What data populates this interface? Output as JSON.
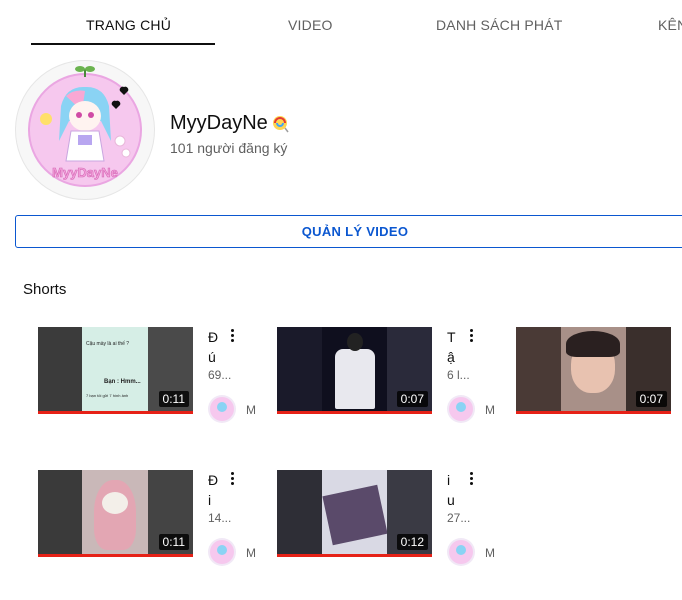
{
  "tabs": [
    {
      "label": "TRANG CHỦ",
      "active": true
    },
    {
      "label": "VIDEO",
      "active": false
    },
    {
      "label": "DANH SÁCH PHÁT",
      "active": false
    },
    {
      "label": "KÊN",
      "active": false
    }
  ],
  "channel": {
    "name": "MyyDayNe",
    "name_icon": "lollipop-icon",
    "subscribers": "101 người đăng ký",
    "avatar_text": "MyyDayNe"
  },
  "manage_button": "QUẢN LÝ VIDEO",
  "section": {
    "title": "Shorts"
  },
  "shorts": [
    {
      "title": "Đ ú",
      "views": "69...",
      "duration": "0:11",
      "channel_initial": "M",
      "thumb_caption_1": "Cậu mày là ai thế ?",
      "thumb_caption_2": "Bạn : Hmm...",
      "thumb_caption_3": "7 bạn tôi gửi 7 hình ảnh"
    },
    {
      "title": "T ậ",
      "views": "6 l...",
      "duration": "0:07",
      "channel_initial": "M"
    },
    {
      "title": "",
      "views": "",
      "duration": "0:07",
      "channel_initial": ""
    },
    {
      "title": "Đ i",
      "views": "14...",
      "duration": "0:11",
      "channel_initial": "M"
    },
    {
      "title": "i u",
      "views": "27...",
      "duration": "0:12",
      "channel_initial": "M"
    }
  ],
  "colors": {
    "accent_blue": "#0b57d0",
    "progress_red": "#e62117",
    "text_primary": "#0f0f0f",
    "text_secondary": "#606060"
  }
}
